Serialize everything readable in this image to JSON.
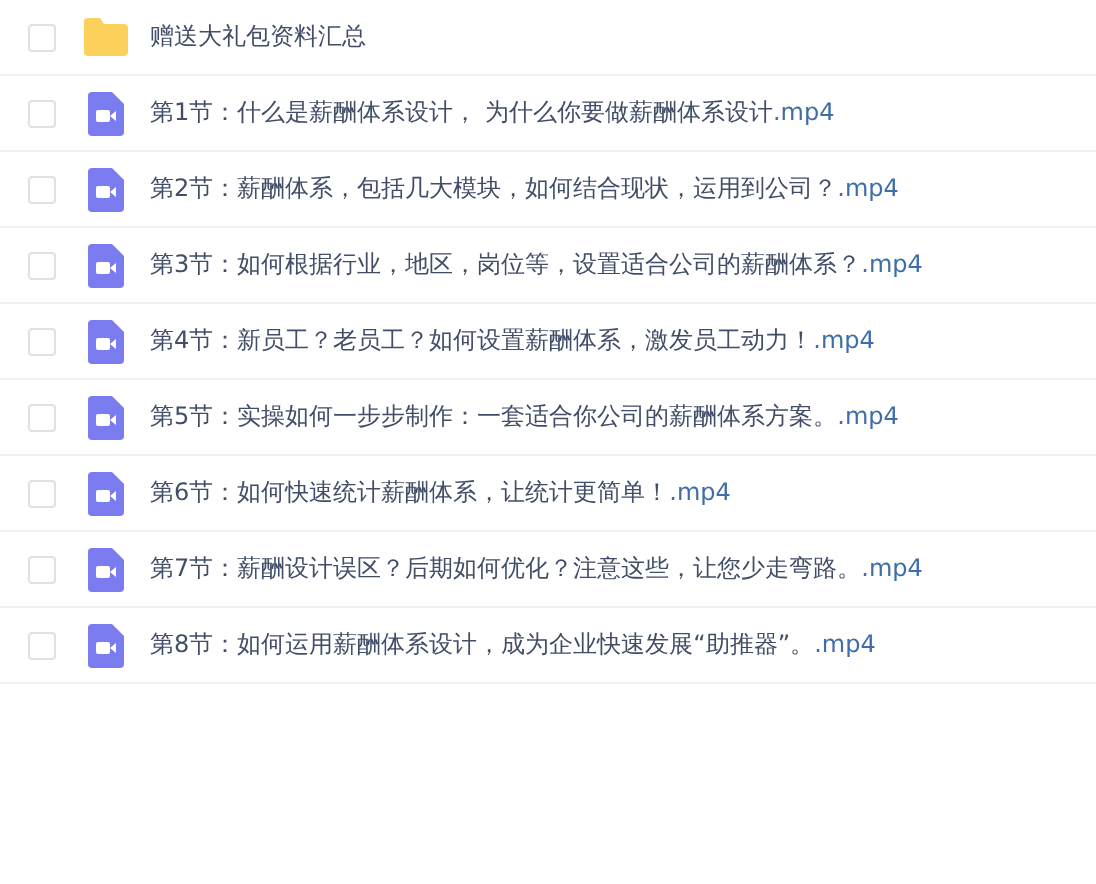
{
  "files": [
    {
      "kind": "folder",
      "checked": false,
      "name": "赠送大礼包资料汇总"
    },
    {
      "kind": "video",
      "checked": false,
      "name": "第1节：什么是薪酬体系设计， 为什么你要做薪酬体系设计",
      "ext": ".mp4"
    },
    {
      "kind": "video",
      "checked": false,
      "name": "第2节：薪酬体系，包括几大模块，如何结合现状，运用到公司？",
      "ext": ".mp4"
    },
    {
      "kind": "video",
      "checked": false,
      "name": "第3节：如何根据行业，地区，岗位等，设置适合公司的薪酬体系？",
      "ext": ".mp4"
    },
    {
      "kind": "video",
      "checked": false,
      "name": "第4节：新员工？老员工？如何设置薪酬体系，激发员工动力！",
      "ext": ".mp4"
    },
    {
      "kind": "video",
      "checked": false,
      "name": "第5节：实操如何一步步制作：一套适合你公司的薪酬体系方案。",
      "ext": ".mp4"
    },
    {
      "kind": "video",
      "checked": false,
      "name": "第6节：如何快速统计薪酬体系，让统计更简单！",
      "ext": ".mp4"
    },
    {
      "kind": "video",
      "checked": false,
      "name": "第7节：薪酬设计误区？后期如何优化？注意这些，让您少走弯路。",
      "ext": ".mp4"
    },
    {
      "kind": "video",
      "checked": false,
      "name": "第8节：如何运用薪酬体系设计，成为企业快速发展“助推器”。",
      "ext": ".mp4"
    }
  ]
}
